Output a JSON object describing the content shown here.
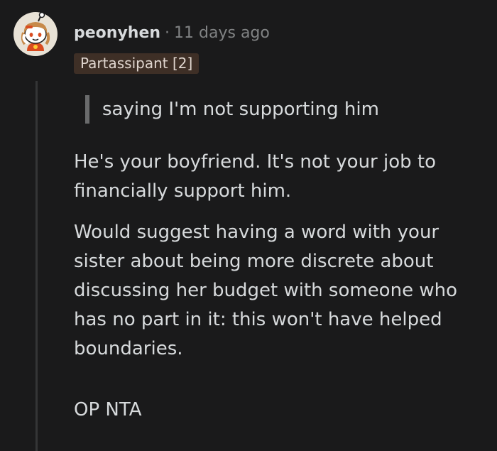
{
  "comment": {
    "username": "peonyhen",
    "separator": "·",
    "timestamp": "11 days ago",
    "flair": "Partassipant [2]",
    "quote": "saying I'm not supporting him",
    "paragraph1": [
      "He's your boyfriend. It's not your job to",
      "financially support him."
    ],
    "paragraph2": [
      "Would suggest having a word with your",
      "sister about being more discrete about",
      "discussing her budget with someone who",
      "has no part in it: this won't have helped",
      "boundaries."
    ],
    "paragraph3": [
      "OP NTA"
    ]
  },
  "avatar": {
    "icon": "reddit-snoo-avatar-icon"
  },
  "colors": {
    "background": "#1a1a1b",
    "text": "#d7dadc",
    "muted": "#818384",
    "flair_bg": "#3e2f26",
    "thread_line": "#343536"
  }
}
